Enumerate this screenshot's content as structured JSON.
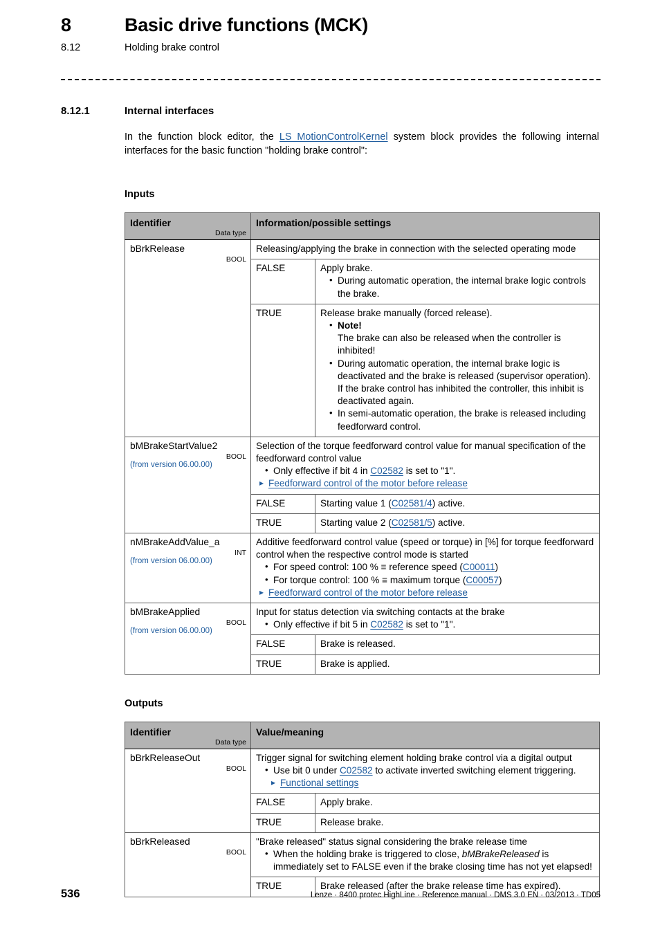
{
  "header": {
    "chapter_number": "8",
    "chapter_title": "Basic drive functions (MCK)",
    "section_number": "8.12",
    "section_title": "Holding brake control"
  },
  "section": {
    "number": "8.12.1",
    "title": "Internal interfaces"
  },
  "intro": {
    "part1": "In the function block editor, the ",
    "link": "LS_MotionControlKernel",
    "part2": " system block provides the following internal interfaces for the basic function \"holding brake control\":"
  },
  "inputs": {
    "heading": "Inputs",
    "columns": {
      "identifier": "Identifier",
      "identifier_sub": "Data type",
      "info": "Information/possible settings"
    },
    "rows": [
      {
        "identifier": "bBrkRelease",
        "data_type": "BOOL",
        "version": "",
        "description": "Releasing/applying the brake in connection with the selected operating mode",
        "values": [
          {
            "value": "FALSE",
            "text": "Apply brake.",
            "bullets": [
              "During automatic operation, the internal brake logic controls the brake."
            ]
          },
          {
            "value": "TRUE",
            "text": "Release brake manually (forced release).",
            "bullets": [
              "Note!",
              "During automatic operation, the internal brake logic is deactivated and the brake is released (supervisor operation). If the brake control has inhibited the controller, this inhibit is deactivated again.",
              "In semi-automatic operation, the brake is released including feedforward control."
            ],
            "note_label": "Note!",
            "note_text": "The brake can also be released when the controller is inhibited!"
          }
        ]
      },
      {
        "identifier": "bMBrakeStartValue2",
        "data_type": "BOOL",
        "version": "(from version 06.00.00)",
        "description": "Selection of the torque feedforward control value for manual specification of the feedforward control value",
        "bullet_prefix": "Only effective if bit 4 in ",
        "bullet_link": "C02582",
        "bullet_suffix": " is set to \"1\".",
        "xref": "Feedforward control of the motor before release",
        "values": [
          {
            "value": "FALSE",
            "prefix": "Starting value 1 (",
            "link": "C02581/4",
            "suffix": ") active."
          },
          {
            "value": "TRUE",
            "prefix": "Starting value 2 (",
            "link": "C02581/5",
            "suffix": ") active."
          }
        ]
      },
      {
        "identifier": "nMBrakeAddValue_a",
        "data_type": "INT",
        "version": "(from version 06.00.00)",
        "description": "Additive feedforward control value (speed or torque) in [%] for torque feedforward control when the respective control mode is started",
        "bullets": [
          {
            "prefix": "For speed control: 100 % ≡ reference speed (",
            "link": "C00011",
            "suffix": ")"
          },
          {
            "prefix": "For torque control: 100 % ≡ maximum torque (",
            "link": "C00057",
            "suffix": ")"
          }
        ],
        "xref": "Feedforward control of the motor before release"
      },
      {
        "identifier": "bMBrakeApplied",
        "data_type": "BOOL",
        "version": "(from version 06.00.00)",
        "description": "Input for status detection via switching contacts at the brake",
        "bullet_prefix": "Only effective if bit 5 in ",
        "bullet_link": "C02582",
        "bullet_suffix": " is set to \"1\".",
        "values": [
          {
            "value": "FALSE",
            "text": "Brake is released."
          },
          {
            "value": "TRUE",
            "text": "Brake is applied."
          }
        ]
      }
    ]
  },
  "outputs": {
    "heading": "Outputs",
    "columns": {
      "identifier": "Identifier",
      "identifier_sub": "Data type",
      "value": "Value/meaning"
    },
    "rows": [
      {
        "identifier": "bBrkReleaseOut",
        "data_type": "BOOL",
        "description": "Trigger signal for switching element holding brake control via a digital output",
        "bullet_prefix": "Use bit 0 under ",
        "bullet_link": "C02582",
        "bullet_suffix": " to activate inverted switching element triggering.",
        "xref": "Functional settings",
        "values": [
          {
            "value": "FALSE",
            "text": "Apply brake."
          },
          {
            "value": "TRUE",
            "text": "Release brake."
          }
        ]
      },
      {
        "identifier": "bBrkReleased",
        "data_type": "BOOL",
        "description": "\"Brake released\" status signal considering the brake release time",
        "bullet_prefix": "When the holding brake is triggered to close, ",
        "bullet_italic": "bMBrakeReleased",
        "bullet_suffix": " is immediately set to FALSE even if the brake closing time has not yet elapsed!",
        "values": [
          {
            "value": "TRUE",
            "text": "Brake released (after the brake release time has expired)."
          }
        ]
      }
    ]
  },
  "footer": {
    "page_number": "536",
    "text": "Lenze · 8400 protec HighLine · Reference manual · DMS 3.0 EN · 03/2013 · TD05"
  }
}
